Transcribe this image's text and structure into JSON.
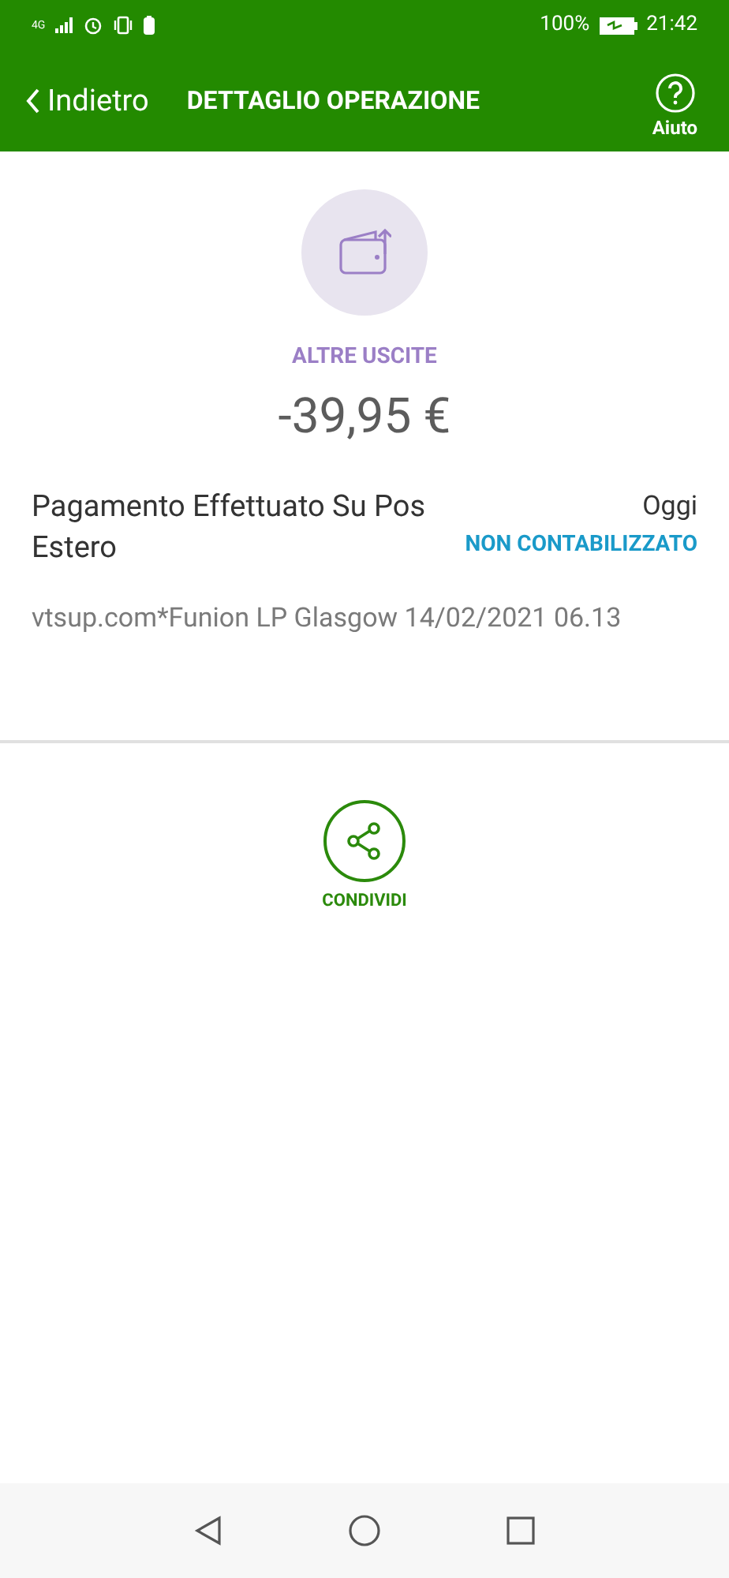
{
  "status_bar": {
    "network": "4G",
    "battery": "100%",
    "time": "21:42"
  },
  "header": {
    "back": "Indietro",
    "title": "DETTAGLIO OPERAZIONE",
    "help": "Aiuto"
  },
  "operation": {
    "category": "ALTRE USCITE",
    "amount": "-39,95 €",
    "description": "Pagamento Effettuato Su Pos Estero",
    "date": "Oggi",
    "status": "NON CONTABILIZZATO",
    "detail": "vtsup.com*Funion LP Glasgow 14/02/2021 06.13"
  },
  "actions": [
    {
      "label": "CONDIVIDI"
    }
  ]
}
